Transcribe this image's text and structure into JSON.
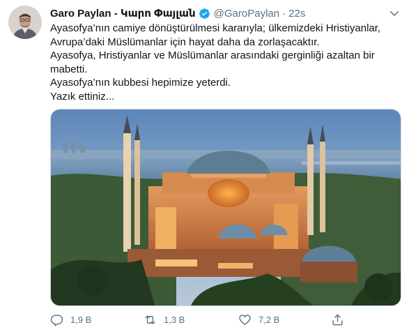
{
  "tweet": {
    "author_name": "Garo Paylan - Կարո Փայլան",
    "handle": "@GaroPaylan",
    "separator": "·",
    "time": "22s",
    "lines": [
      "Ayasofya’nın camiye dönüştürülmesi kararıyla; ülkemizdeki Hristiyanlar,",
      "Avrupa’daki Müslümanlar için hayat daha da zorlaşacaktır.",
      "Ayasofya, Hristiyanlar ve Müslümanlar arasındaki gerginliği azaltan bir",
      "mabetti.",
      "Ayasofya’nın kubbesi hepimize yeterdi.",
      "Yazık ettiniz..."
    ]
  },
  "actions": {
    "replies": "1,9 B",
    "retweets": "1,3 B",
    "likes": "7,2 B"
  },
  "icons": {
    "verified": "verified-badge-icon",
    "more": "chevron-down-icon",
    "reply": "reply-icon",
    "retweet": "retweet-icon",
    "like": "heart-icon",
    "share": "share-icon"
  },
  "colors": {
    "verified_blue": "#1da1f2",
    "secondary_text": "#5b7083",
    "primary_text": "#0f1419"
  }
}
